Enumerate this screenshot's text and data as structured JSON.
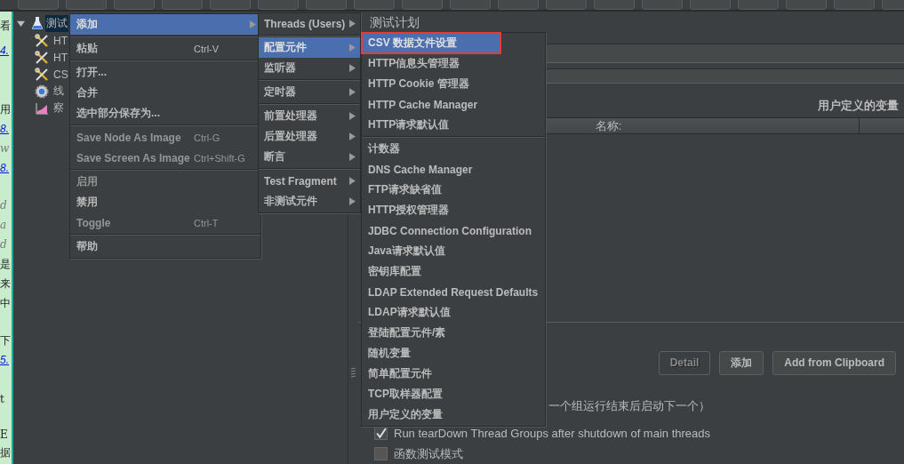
{
  "background_page": {
    "fragments": [
      {
        "text": "看",
        "kind": "plain"
      },
      {
        "text": "4.",
        "kind": "link"
      },
      {
        "text": "用",
        "kind": "plain"
      },
      {
        "text": "8.",
        "kind": "link"
      },
      {
        "text": "w",
        "kind": "muted"
      },
      {
        "text": "8.",
        "kind": "link"
      },
      {
        "text": "d",
        "kind": "muted"
      },
      {
        "text": "a",
        "kind": "muted"
      },
      {
        "text": "d",
        "kind": "muted"
      },
      {
        "text": "是",
        "kind": "plain"
      },
      {
        "text": "来",
        "kind": "plain"
      },
      {
        "text": "中",
        "kind": "plain"
      },
      {
        "text": "下",
        "kind": "plain"
      },
      {
        "text": "5.",
        "kind": "link"
      },
      {
        "text": "t",
        "kind": "plain"
      },
      {
        "text": "E",
        "kind": "plain"
      },
      {
        "text": "据",
        "kind": "plain"
      }
    ]
  },
  "tree": {
    "items": [
      {
        "label": "测试",
        "kind": "flask",
        "selected": true,
        "expanded": true,
        "children": [
          {
            "label": "HT",
            "kind": "tools",
            "selected": false
          },
          {
            "label": "HT",
            "kind": "tools",
            "selected": false
          },
          {
            "label": "CS",
            "kind": "tools",
            "selected": false
          },
          {
            "label": "线",
            "kind": "gear",
            "selected": false
          },
          {
            "label": "察",
            "kind": "chart",
            "selected": false
          }
        ]
      }
    ]
  },
  "context_menu": {
    "groups": [
      [
        {
          "label": "添加",
          "submenu": true,
          "selected": true,
          "disabled": false
        }
      ],
      [
        {
          "label": "粘贴",
          "shortcut": "Ctrl-V",
          "selected": false,
          "disabled": false
        }
      ],
      [
        {
          "label": "打开...",
          "selected": false,
          "disabled": false
        },
        {
          "label": "合并",
          "selected": false,
          "disabled": false
        },
        {
          "label": "选中部分保存为...",
          "selected": false,
          "disabled": false
        }
      ],
      [
        {
          "label": "Save Node As Image",
          "shortcut": "Ctrl-G",
          "selected": false,
          "disabled": true
        },
        {
          "label": "Save Screen As Image",
          "shortcut": "Ctrl+Shift-G",
          "selected": false,
          "disabled": true
        }
      ],
      [
        {
          "label": "启用",
          "selected": false,
          "disabled": true
        },
        {
          "label": "禁用",
          "selected": false,
          "disabled": false
        },
        {
          "label": "Toggle",
          "shortcut": "Ctrl-T",
          "selected": false,
          "disabled": true
        }
      ],
      [
        {
          "label": "帮助",
          "selected": false,
          "disabled": false
        }
      ]
    ]
  },
  "add_submenu": {
    "groups": [
      [
        {
          "label": "Threads (Users)",
          "selected": false
        }
      ],
      [
        {
          "label": "配置元件",
          "selected": true
        },
        {
          "label": "监听器",
          "selected": false
        }
      ],
      [
        {
          "label": "定时器",
          "selected": false
        }
      ],
      [
        {
          "label": "前置处理器",
          "selected": false
        },
        {
          "label": "后置处理器",
          "selected": false
        },
        {
          "label": "断言",
          "selected": false
        }
      ],
      [
        {
          "label": "Test Fragment",
          "selected": false
        },
        {
          "label": "非测试元件",
          "selected": false
        }
      ]
    ]
  },
  "config_submenu": {
    "groups": [
      [
        {
          "label": "CSV 数据文件设置",
          "selected": true,
          "outlined": true
        },
        {
          "label": "HTTP信息头管理器",
          "selected": false,
          "outlined": false
        },
        {
          "label": "HTTP Cookie 管理器",
          "selected": false,
          "outlined": false
        },
        {
          "label": "HTTP Cache Manager",
          "selected": false,
          "outlined": false
        },
        {
          "label": "HTTP请求默认值",
          "selected": false,
          "outlined": false
        }
      ],
      [
        {
          "label": "计数器",
          "selected": false,
          "outlined": false
        },
        {
          "label": "DNS Cache Manager",
          "selected": false,
          "outlined": false
        },
        {
          "label": "FTP请求缺省值",
          "selected": false,
          "outlined": false
        },
        {
          "label": "HTTP授权管理器",
          "selected": false,
          "outlined": false
        },
        {
          "label": "JDBC Connection Configuration",
          "selected": false,
          "outlined": false
        },
        {
          "label": "Java请求默认值",
          "selected": false,
          "outlined": false
        },
        {
          "label": "密钥库配置",
          "selected": false,
          "outlined": false
        },
        {
          "label": "LDAP Extended Request Defaults",
          "selected": false,
          "outlined": false
        },
        {
          "label": "LDAP请求默认值",
          "selected": false,
          "outlined": false
        },
        {
          "label": "登陆配置元件/素",
          "selected": false,
          "outlined": false
        },
        {
          "label": "随机变量",
          "selected": false,
          "outlined": false
        },
        {
          "label": "简单配置元件",
          "selected": false,
          "outlined": false
        },
        {
          "label": "TCP取样器配置",
          "selected": false,
          "outlined": false
        },
        {
          "label": "用户定义的变量",
          "selected": false,
          "outlined": false
        }
      ]
    ]
  },
  "test_plan": {
    "title": "测试计划",
    "variables_label": "用户定义的变量",
    "table": {
      "columns": [
        "名称:"
      ]
    },
    "buttons": [
      {
        "label": "Detail",
        "disabled": true
      },
      {
        "label": "添加",
        "disabled": false
      },
      {
        "label": "Add from Clipboard",
        "disabled": false
      }
    ],
    "note": "一个组运行结束后启动下一个）",
    "options": [
      {
        "label": "Run tearDown Thread Groups after shutdown of main threads",
        "checked": true
      },
      {
        "label": "函数测试模式",
        "checked": false
      }
    ]
  }
}
